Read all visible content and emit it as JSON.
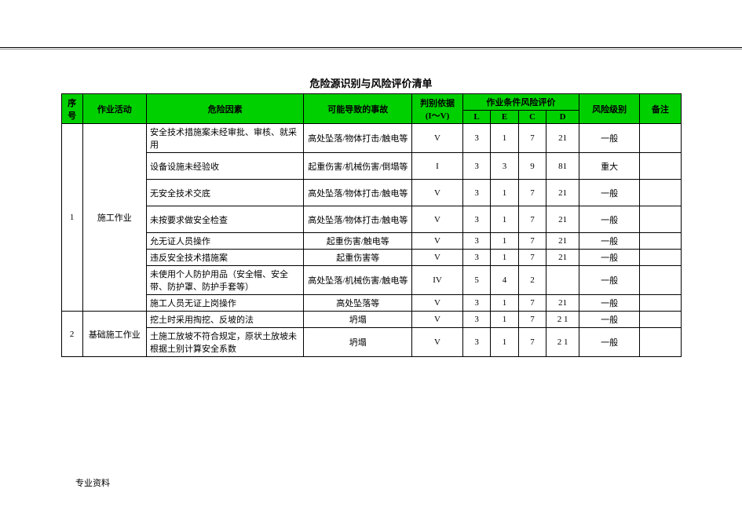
{
  "title": "危险源识别与风险评价清单",
  "headers": {
    "index": "序号",
    "activity": "作业活动",
    "factor": "危险因素",
    "accident": "可能导致的事故",
    "basis_line1": "判别依据",
    "basis_line2": "(I～V)",
    "eval_group": "作业条件风险评价",
    "L": "L",
    "E": "E",
    "C": "C",
    "D": "D",
    "level": "风险级别",
    "note": "备注"
  },
  "groups": [
    {
      "index": "1",
      "activity": "施工作业",
      "rows": [
        {
          "factor": "安全技术措施案未经审批、审核、就采用",
          "accident": "高处坠落/物体打击/触电等",
          "basis": "V",
          "L": "3",
          "E": "1",
          "C": "7",
          "D": "21",
          "level": "一般",
          "note": ""
        },
        {
          "factor": "设备设施未经验收",
          "accident": "起重伤害/机械伤害/倒塌等",
          "basis": "I",
          "L": "3",
          "E": "3",
          "C": "9",
          "D": "81",
          "level": "重大",
          "note": ""
        },
        {
          "factor": "无安全技术交底",
          "accident": "高处坠落/物体打击/触电等",
          "basis": "V",
          "L": "3",
          "E": "1",
          "C": "7",
          "D": "21",
          "level": "一般",
          "note": ""
        },
        {
          "factor": "未按要求做安全检查",
          "accident": "高处坠落/物体打击/触电等",
          "basis": "V",
          "L": "3",
          "E": "1",
          "C": "7",
          "D": "21",
          "level": "一般",
          "note": ""
        },
        {
          "factor": "允无证人员操作",
          "accident": "起重伤害/触电等",
          "basis": "V",
          "L": "3",
          "E": "1",
          "C": "7",
          "D": "21",
          "level": "一般",
          "note": ""
        },
        {
          "factor": "违反安全技术措施案",
          "accident": "起重伤害等",
          "basis": "V",
          "L": "3",
          "E": "1",
          "C": "7",
          "D": "21",
          "level": "一般",
          "note": ""
        },
        {
          "factor": "未使用个人防护用品（安全帽、安全带、防护罩、防护手套等）",
          "accident": "高处坠落/机械伤害/触电等",
          "basis": "IV",
          "L": "5",
          "E": "4",
          "C": "2",
          "D": "",
          "level": "一般",
          "note": ""
        },
        {
          "factor": "施工人员无证上岗操作",
          "accident": "高处坠落等",
          "basis": "V",
          "L": "3",
          "E": "1",
          "C": "7",
          "D": "21",
          "level": "一般",
          "note": ""
        }
      ]
    },
    {
      "index": "2",
      "activity": "基础施工作业",
      "rows": [
        {
          "factor": "挖土时采用掏挖、反坡的法",
          "accident": "坍塌",
          "basis": "V",
          "L": "3",
          "E": "1",
          "C": "7",
          "D": "2 1",
          "level": "一般",
          "note": ""
        },
        {
          "factor": "土施工放坡不符合规定，原状土放坡未根据土别计算安全系数",
          "accident": "坍塌",
          "basis": "V",
          "L": "3",
          "E": "1",
          "C": "7",
          "D": "2 1",
          "level": "一般",
          "note": ""
        }
      ]
    }
  ],
  "footer": "专业资料"
}
